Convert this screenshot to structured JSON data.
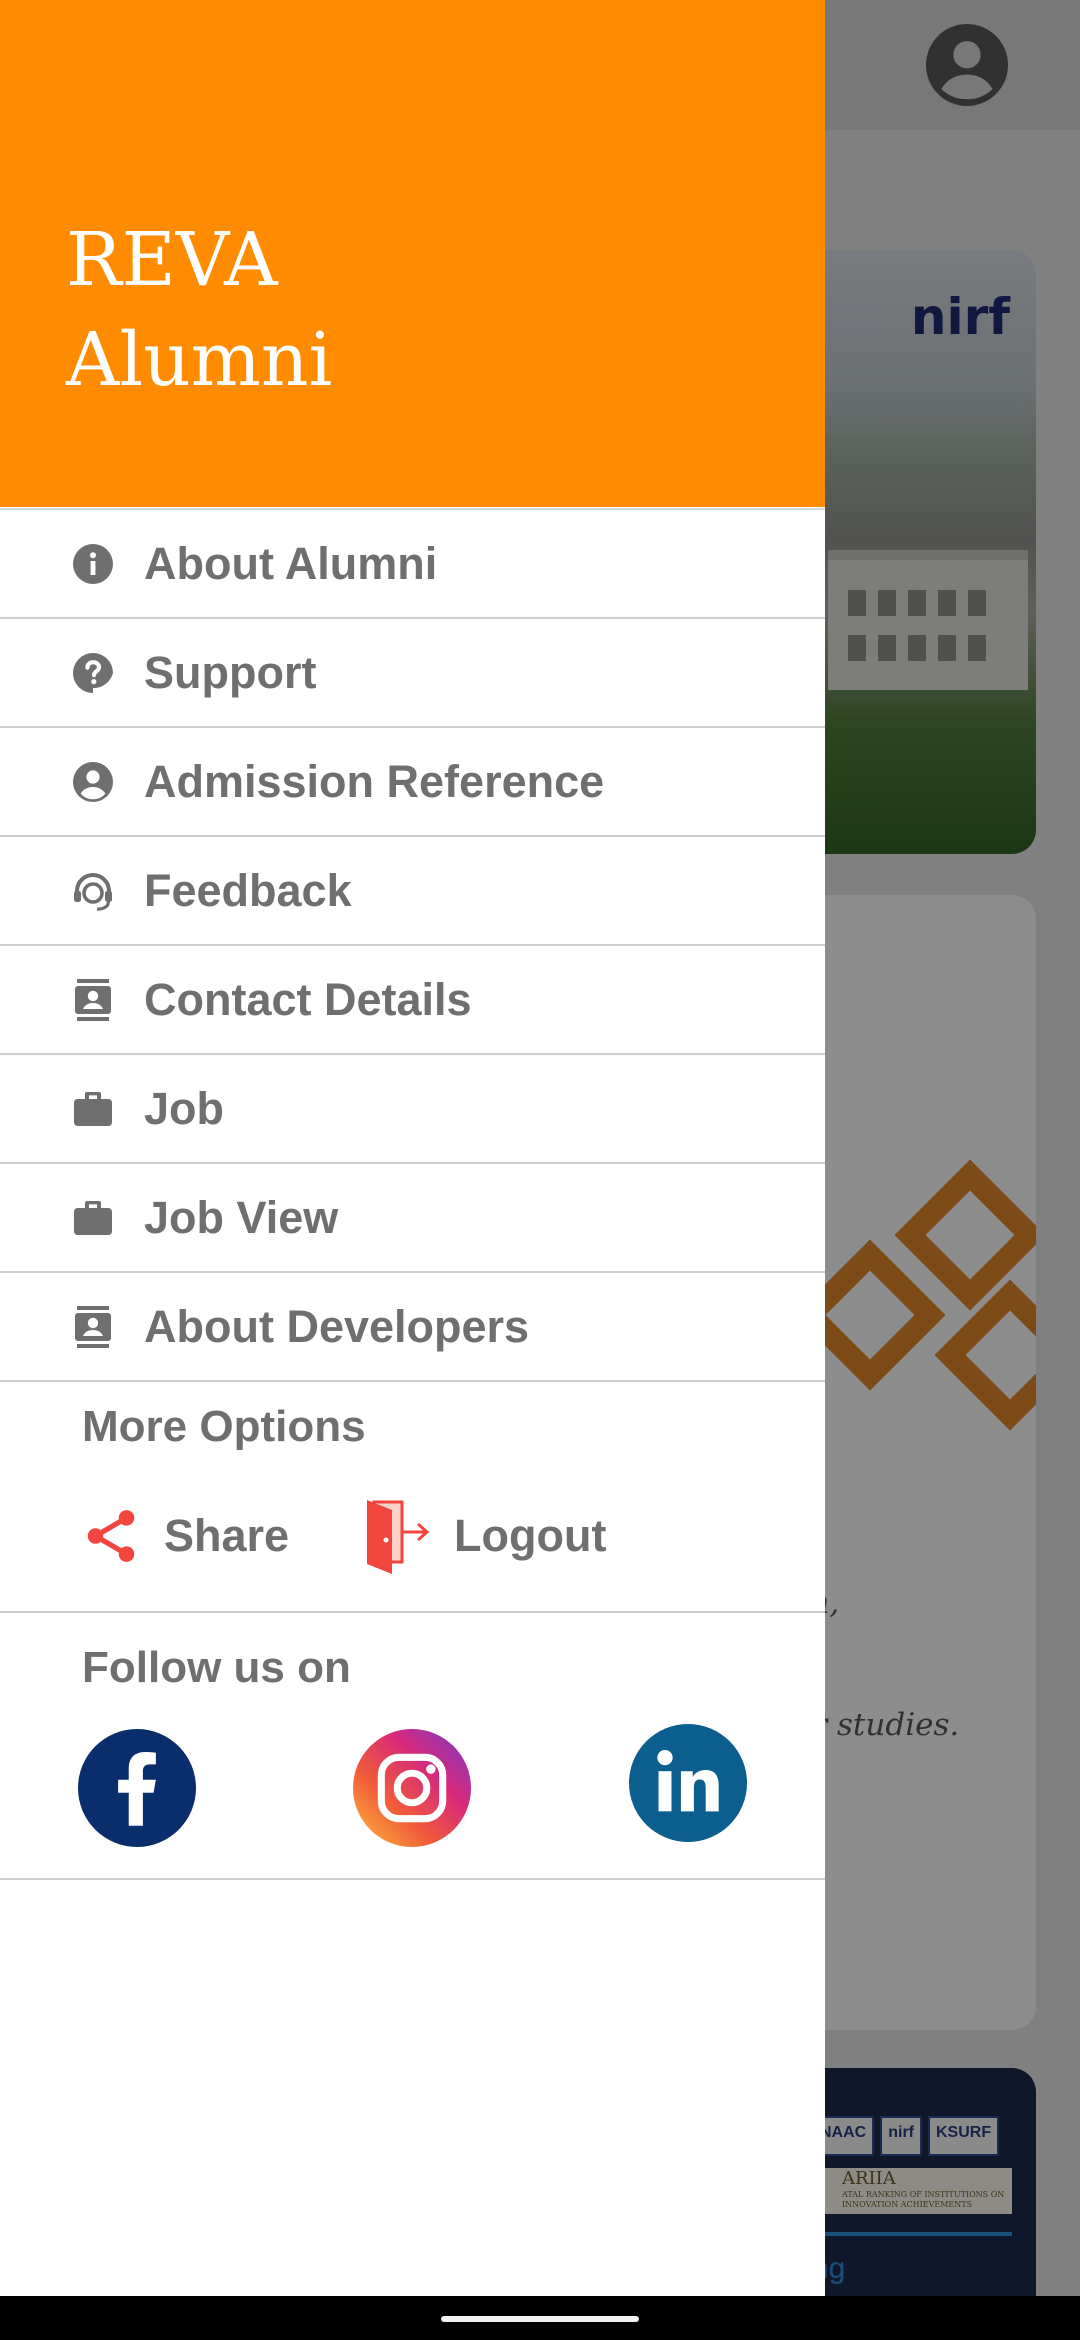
{
  "drawer": {
    "title": "REVA\nAlumni",
    "menu": [
      {
        "label": "About Alumni",
        "icon": "info-icon"
      },
      {
        "label": "Support",
        "icon": "help-icon"
      },
      {
        "label": "Admission Reference",
        "icon": "account-circle-icon"
      },
      {
        "label": "Feedback",
        "icon": "support-agent-icon"
      },
      {
        "label": "Contact Details",
        "icon": "contacts-icon"
      },
      {
        "label": "Job",
        "icon": "briefcase-icon"
      },
      {
        "label": "Job View",
        "icon": "briefcase-icon"
      },
      {
        "label": "About Developers",
        "icon": "contacts-icon"
      }
    ],
    "more_options": {
      "title": "More Options",
      "share_label": "Share",
      "logout_label": "Logout"
    },
    "follow": {
      "title": "Follow us on",
      "networks": [
        "facebook-icon",
        "instagram-icon",
        "linkedin-icon"
      ]
    }
  },
  "background": {
    "card1_logo": "nirf",
    "card2_text_1": "m,",
    "card2_text_2": "er studies.",
    "card3_badges": [
      "NAAC",
      "nirf",
      "KSURF"
    ],
    "card3_ariia": "ARIIA",
    "card3_ariia_sub": "ATAL RANKING OF INSTITUTIONS ON INNOVATION ACHIEVEMENTS",
    "card3_text": "ng"
  },
  "colors": {
    "header": "#ff8c00",
    "icon_gray": "#6f6f6f",
    "accent_red": "#f0463e",
    "facebook": "#0a2e6b",
    "linkedin": "#0b5e8e"
  }
}
